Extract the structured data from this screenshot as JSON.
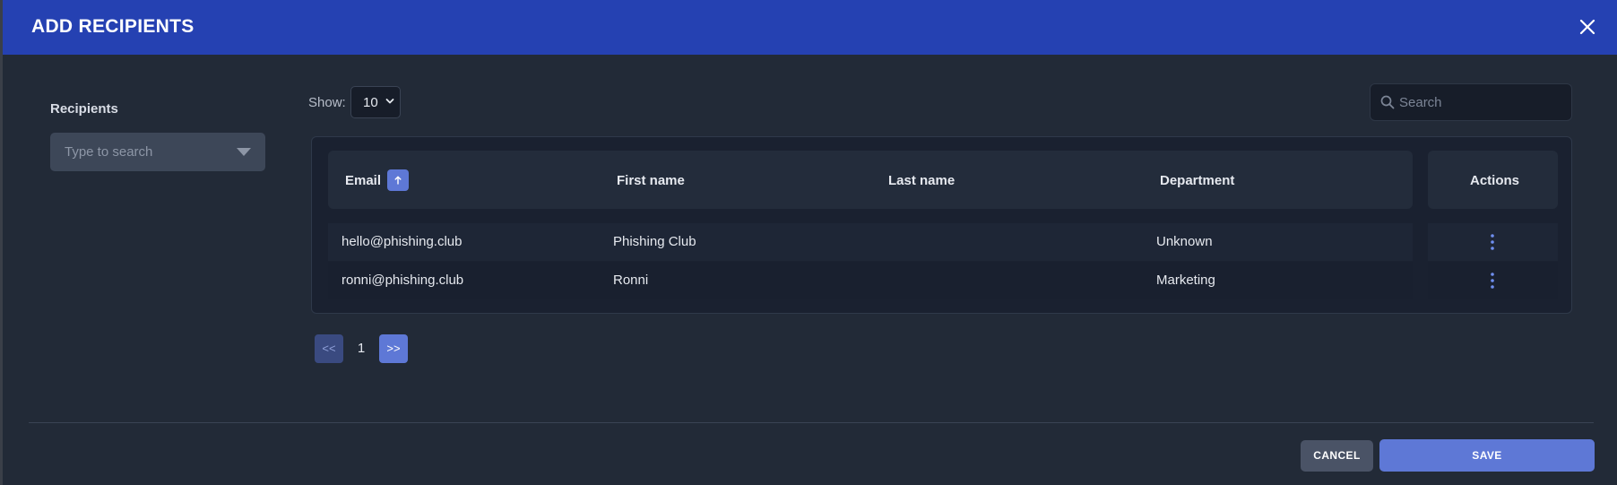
{
  "dialog": {
    "title": "ADD RECIPIENTS",
    "close_icon": "close-icon"
  },
  "recipients": {
    "label": "Recipients",
    "placeholder": "Type to search",
    "caret_icon": "caret-down-icon"
  },
  "pagination_size": {
    "label": "Show:",
    "value": "10",
    "chevron_icon": "chevron-down-icon"
  },
  "search": {
    "placeholder": "Search",
    "icon": "search-icon"
  },
  "table": {
    "columns": {
      "email": "Email",
      "first_name": "First name",
      "last_name": "Last name",
      "department": "Department",
      "actions": "Actions"
    },
    "sort_icon": "arrow-up-icon",
    "rows": [
      {
        "email": "hello@phishing.club",
        "first_name": "Phishing Club",
        "last_name": "",
        "department": "Unknown"
      },
      {
        "email": "ronni@phishing.club",
        "first_name": "Ronni",
        "last_name": "",
        "department": "Marketing"
      }
    ],
    "row_action_icon": "kebab-menu-icon"
  },
  "pager": {
    "prev": "<<",
    "current": "1",
    "next": ">>"
  },
  "footer": {
    "cancel": "CANCEL",
    "save": "SAVE"
  },
  "colors": {
    "header_bg": "#2541b2",
    "accent": "#5e78d6",
    "surface": "#222a37"
  }
}
